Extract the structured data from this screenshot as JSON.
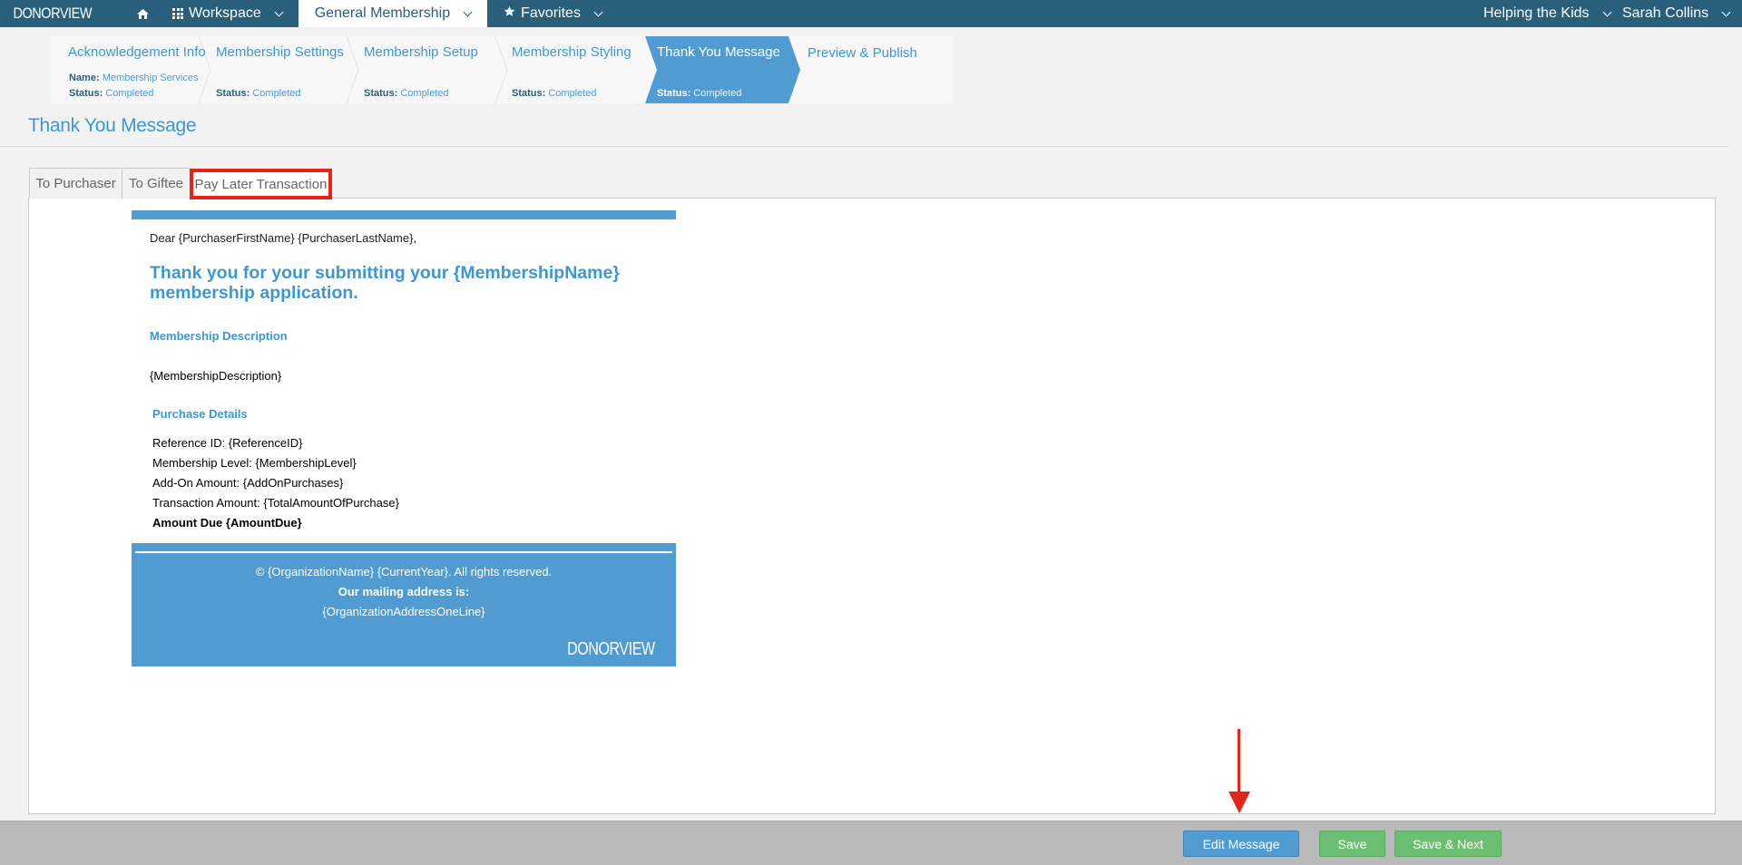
{
  "brand": "DONORVIEW",
  "nav": {
    "home_icon": "home-icon",
    "workspace": "Workspace",
    "general_membership": "General Membership",
    "favorites": "Favorites",
    "org": "Helping the Kids",
    "user": "Sarah Collins"
  },
  "steps": [
    {
      "title": "Acknowledgement Info",
      "name_label": "Name:",
      "name_value": "Membership Services",
      "status_label": "Status:",
      "status_value": "Completed"
    },
    {
      "title": "Membership Settings",
      "status_label": "Status:",
      "status_value": "Completed"
    },
    {
      "title": "Membership Setup",
      "status_label": "Status:",
      "status_value": "Completed"
    },
    {
      "title": "Membership Styling",
      "status_label": "Status:",
      "status_value": "Completed"
    },
    {
      "title": "Thank You Message",
      "status_label": "Status:",
      "status_value": "Completed"
    },
    {
      "title": "Preview & Publish"
    }
  ],
  "page_title": "Thank You Message",
  "tabs": [
    "To Purchaser",
    "To Giftee",
    "Pay Later Transaction"
  ],
  "email": {
    "greeting": "Dear {PurchaserFirstName} {PurchaserLastName},",
    "headline_1": "Thank you for your submitting your {MembershipName}",
    "headline_2": "membership application.",
    "desc_heading": "Membership Description",
    "desc": "{MembershipDescription}",
    "details_heading": "Purchase Details",
    "details": [
      "Reference ID: {ReferenceID}",
      "Membership Level: {MembershipLevel}",
      "Add-On Amount: {AddOnPurchases}",
      "Transaction Amount: {TotalAmountOfPurchase}"
    ],
    "amount_due": "Amount Due {AmountDue}",
    "footer_copyright": "© {OrganizationName} {CurrentYear}. All rights reserved.",
    "footer_mailing": "Our mailing address is:",
    "footer_address": "{OrganizationAddressOneLine}",
    "footer_logo": "DONORVIEW"
  },
  "buttons": {
    "edit": "Edit Message",
    "save": "Save",
    "save_next": "Save & Next"
  },
  "colors": {
    "nav": "#2a5f7c",
    "accent": "#3f97d0",
    "active_step": "#4f9bd2",
    "highlight": "#e1251b",
    "green": "#6cbf72"
  }
}
